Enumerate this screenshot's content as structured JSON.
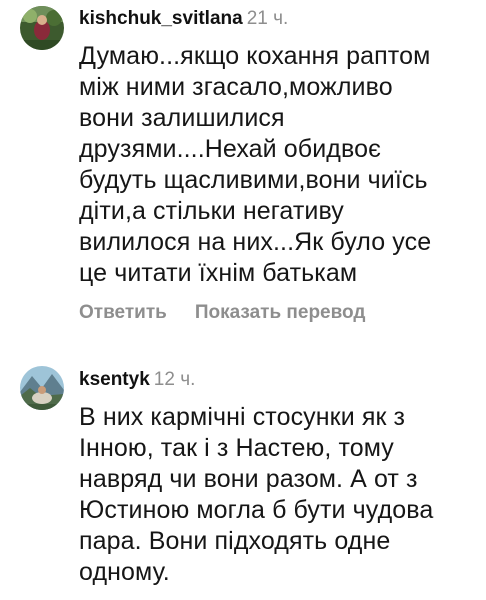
{
  "comments": [
    {
      "username": "kishchuk_svitlana",
      "time": "21 ч.",
      "avatar_icon": "profile-photo-icon",
      "lines": [
        "Думаю...якщо кохання раптом",
        "між ними згасало,можливо",
        "вони залишилися",
        "друзями....Нехай обидвоє",
        "будуть щасливими,вони чиїсь",
        "діти,а стільки негативу",
        "вилилося на них...Як було усе",
        "це читати їхнім батькам"
      ],
      "reply_label": "Ответить",
      "translate_label": "Показать перевод"
    },
    {
      "username": "ksentyk",
      "time": "12 ч.",
      "avatar_icon": "profile-photo-icon",
      "lines": [
        "В них кармічні стосунки як з",
        "Інною, так і з Настею, тому",
        "навряд чи вони разом. А от з",
        "Юстиною могла б бути чудова",
        "пара. Вони підходять одне",
        "одному."
      ]
    }
  ]
}
